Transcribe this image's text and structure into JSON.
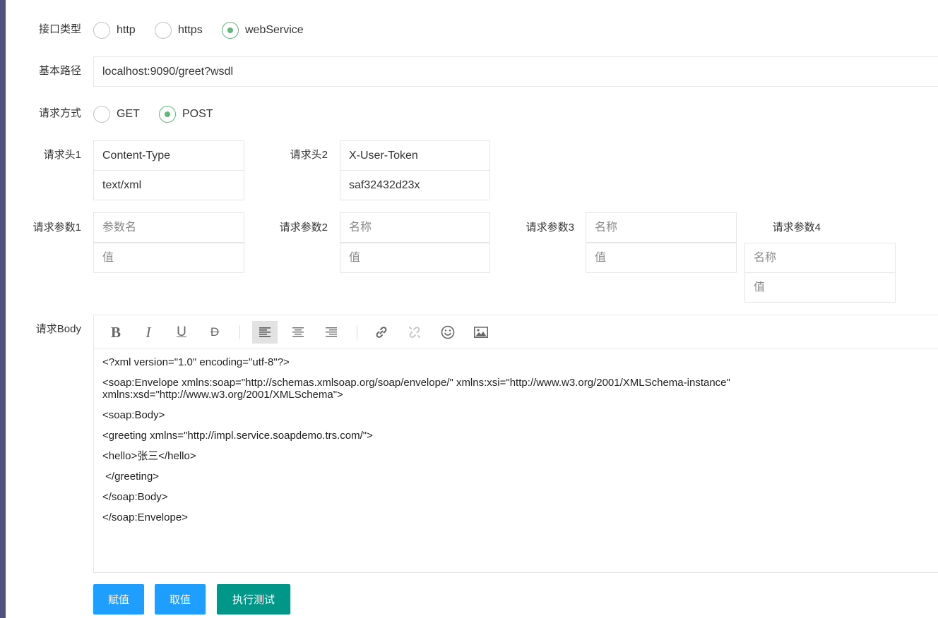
{
  "form": {
    "interface_type": {
      "label": "接口类型",
      "options": [
        "http",
        "https",
        "webService"
      ],
      "selected": "webService"
    },
    "base_path": {
      "label": "基本路径",
      "value": "localhost:9090/greet?wsdl"
    },
    "request_method": {
      "label": "请求方式",
      "options": [
        "GET",
        "POST"
      ],
      "selected": "POST"
    },
    "headers": [
      {
        "label": "请求头1",
        "name": "Content-Type",
        "value": "text/xml"
      },
      {
        "label": "请求头2",
        "name": "X-User-Token",
        "value": "saf32432d23x"
      }
    ],
    "params": [
      {
        "label": "请求参数1",
        "name_placeholder": "参数名",
        "value_placeholder": "值"
      },
      {
        "label": "请求参数2",
        "name_placeholder": "名称",
        "value_placeholder": "值"
      },
      {
        "label": "请求参数3",
        "name_placeholder": "名称",
        "value_placeholder": "值"
      },
      {
        "label": "请求参数4",
        "name_placeholder": "名称",
        "value_placeholder": "值"
      }
    ],
    "body": {
      "label": "请求Body",
      "toolbar": [
        "bold-icon",
        "italic-icon",
        "underline-icon",
        "strikethrough-icon",
        "align-left-icon",
        "align-center-icon",
        "align-right-icon",
        "link-icon",
        "unlink-icon",
        "emoji-icon",
        "image-icon"
      ],
      "lines": {
        "l1": "<?xml version=\"1.0\" encoding=\"utf-8\"?>",
        "l2": "<soap:Envelope xmlns:soap=\"http://schemas.xmlsoap.org/soap/envelope/\" xmlns:xsi=\"http://www.w3.org/2001/XMLSchema-instance\" xmlns:xsd=\"http://www.w3.org/2001/XMLSchema\">",
        "l3": "<soap:Body>",
        "l4": "<greeting xmlns=\"http://impl.service.soapdemo.trs.com/\">",
        "l5": "<hello>张三</hello>",
        "l6": " </greeting>",
        "l7": "</soap:Body>",
        "l8": "</soap:Envelope>"
      }
    }
  },
  "buttons": {
    "assign": "赋值",
    "fetch": "取值",
    "execute": "执行测试"
  },
  "colors": {
    "sidebar": "#50527f",
    "radio_checked": "#5fb878",
    "button_blue": "#1e9fff",
    "button_green": "#009688"
  }
}
